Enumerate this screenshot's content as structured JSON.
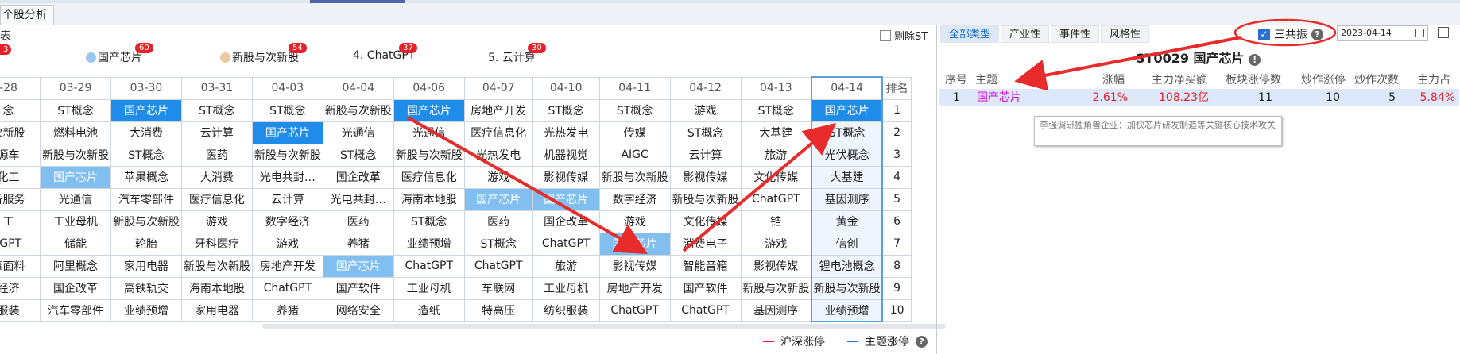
{
  "window": {
    "tab_title": "个股分析"
  },
  "left_panel": {
    "section_label": "表",
    "partial_badge": "3",
    "remove_st_label": "剔除ST",
    "topics": [
      {
        "icon": "chip-icon",
        "label": "国产芯片",
        "badge": "60"
      },
      {
        "icon": "new-stock-icon",
        "label": "新股与次新股",
        "badge": "54"
      },
      {
        "label": "4. ChatGPT",
        "badge": "37"
      },
      {
        "label": "5. 云计算",
        "badge": "30"
      }
    ],
    "rank_header": "排名",
    "dates": [
      "-28",
      "03-29",
      "03-30",
      "03-31",
      "04-03",
      "04-04",
      "04-06",
      "04-07",
      "04-10",
      "04-11",
      "04-12",
      "04-13",
      "04-14"
    ],
    "rows": [
      {
        "rank": "1",
        "cells": [
          "念",
          "ST概念",
          "国产芯片",
          "ST概念",
          "ST概念",
          "新股与次新股",
          "国产芯片",
          "房地产开发",
          "ST概念",
          "ST概念",
          "游戏",
          "ST概念",
          "国产芯片"
        ]
      },
      {
        "rank": "2",
        "cells": [
          "次新股",
          "燃料电池",
          "大消费",
          "云计算",
          "国产芯片",
          "光通信",
          "光通信",
          "医疗信息化",
          "光热发电",
          "传媒",
          "ST概念",
          "大基建",
          "ST概念"
        ]
      },
      {
        "rank": "3",
        "cells": [
          "源车",
          "新股与次新股",
          "ST概念",
          "医药",
          "新股与次新股",
          "ST概念",
          "新股与次新股",
          "光热发电",
          "机器视觉",
          "AIGC",
          "云计算",
          "旅游",
          "光伏概念"
        ]
      },
      {
        "rank": "4",
        "cells": [
          "化工",
          "国产芯片",
          "苹果概念",
          "大消费",
          "光电共封…",
          "国企改革",
          "医疗信息化",
          "游戏",
          "影视传媒",
          "新股与次新股",
          "影视传媒",
          "文化传媒",
          "大基建"
        ]
      },
      {
        "rank": "5",
        "cells": [
          "备服务",
          "光通信",
          "汽车零部件",
          "医疗信息化",
          "云计算",
          "光电共封…",
          "海南本地股",
          "国产芯片",
          "国产芯片",
          "数字经济",
          "新股与次新股",
          "ChatGPT",
          "基因测序"
        ]
      },
      {
        "rank": "6",
        "cells": [
          "工",
          "工业母机",
          "新股与次新股",
          "游戏",
          "数字经济",
          "医药",
          "ST概念",
          "医药",
          "国企改革",
          "游戏",
          "文化传媒",
          "锆",
          "黄金"
        ]
      },
      {
        "rank": "7",
        "cells": [
          "tGPT",
          "储能",
          "轮胎",
          "牙科医疗",
          "游戏",
          "养猪",
          "业绩预增",
          "ST概念",
          "ChatGPT",
          "国产芯片",
          "消费电子",
          "游戏",
          "信创"
        ]
      },
      {
        "rank": "8",
        "cells": [
          "毒面料",
          "阿里概念",
          "家用电器",
          "新股与次新股",
          "房地产开发",
          "国产芯片",
          "ChatGPT",
          "ChatGPT",
          "旅游",
          "影视传媒",
          "智能音箱",
          "影视传媒",
          "锂电池概念"
        ]
      },
      {
        "rank": "9",
        "cells": [
          "经济",
          "国企改革",
          "高铁轨交",
          "海南本地股",
          "ChatGPT",
          "国产软件",
          "工业母机",
          "车联网",
          "工业母机",
          "房地产开发",
          "国产软件",
          "新股与次新股",
          "新股与次新股"
        ]
      },
      {
        "rank": "10",
        "cells": [
          "服装",
          "汽车零部件",
          "业绩预增",
          "家用电器",
          "养猪",
          "网络安全",
          "造纸",
          "特高压",
          "纺织服装",
          "ChatGPT",
          "ChatGPT",
          "基因测序",
          "业绩预增"
        ]
      }
    ],
    "legend": {
      "hs_label": "沪深涨停",
      "topic_label": "主题涨停"
    }
  },
  "right_panel": {
    "tabs": [
      "全部类型",
      "产业性",
      "事件性",
      "风格性"
    ],
    "active_tab": "全部类型",
    "sgz_label": "三共振",
    "sgz_checked": true,
    "date_value": "2023-04-14",
    "title": "ST0029 国产芯片",
    "columns": [
      "序号",
      "主题",
      "涨幅",
      "主力净买额",
      "板块涨停数",
      "炒作涨停",
      "炒作次数",
      "主力占比"
    ],
    "row": {
      "index": "1",
      "topic": "国产芯片",
      "change": "2.61%",
      "net_buy": "108.23亿",
      "limit_up": "11",
      "hype_limit": "10",
      "hype_times": "5",
      "main_ratio": "5.84%"
    },
    "tooltip": "李强调研独角兽企业：加快芯片研发制造等关键核心技术攻关"
  },
  "colors": {
    "highlight": "#1e8ce8",
    "light_highlight": "#80bff0",
    "up_red": "#e8202a",
    "topic_magenta": "#d80ee0",
    "hs_line": "#e8202a",
    "topic_line": "#2c6fd1"
  }
}
